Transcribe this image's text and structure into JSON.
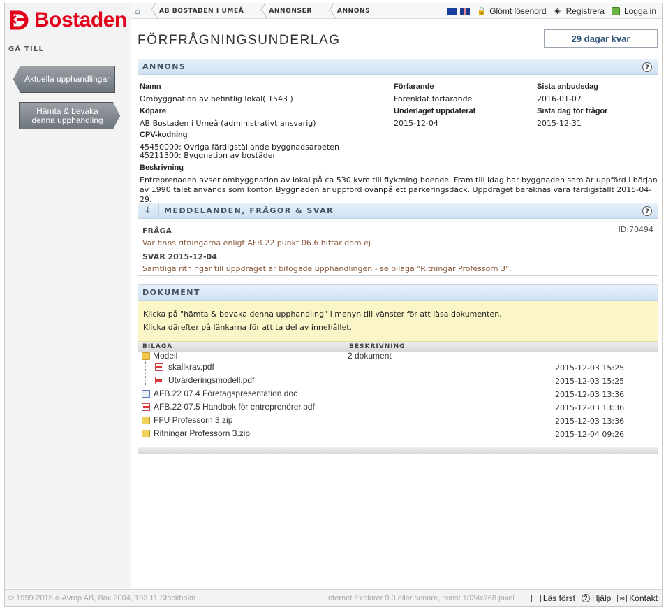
{
  "brand": {
    "name": "Bostaden",
    "color": "#e3001b"
  },
  "sidebar": {
    "goto_label": "GÅ TILL",
    "buttons": [
      {
        "label": "Aktuella upphandlingar"
      },
      {
        "label": "Hämta & bevaka denna upphandling"
      }
    ]
  },
  "breadcrumb": [
    "AB BOSTADEN I UMEÅ",
    "ANNONSER",
    "ANNONS"
  ],
  "toplinks": {
    "forgot": "Glömt lösenord",
    "register": "Registrera",
    "login": "Logga in"
  },
  "page": {
    "title": "FÖRFRÅGNINGSUNDERLAG",
    "days_left": "29 dagar kvar"
  },
  "annons": {
    "header": "ANNONS",
    "namn_label": "Namn",
    "namn": "Ombyggnation av befintlig lokal( 1543 )",
    "kopare_label": "Köpare",
    "kopare": "AB Bostaden i Umeå (administrativt ansvarig)",
    "cpv_label": "CPV-kodning",
    "cpv": [
      "45450000: Övriga färdigställande byggnadsarbeten",
      "45211300: Byggnation av bostäder"
    ],
    "beskrivning_label": "Beskrivning",
    "beskrivning": "Entreprenaden avser ombyggnation av lokal på ca 530 kvm till flyktning boende. Fram till idag har byggnaden som är uppförd i början av 1990 talet används som kontor. Byggnaden är uppförd ovanpå ett parkeringsdäck. Uppdraget beräknas vara färdigställt 2015-04-29.",
    "forfarande_label": "Förfarande",
    "forfarande": "Förenklat förfarande",
    "uppdaterat_label": "Underlaget uppdaterat",
    "uppdaterat": "2015-12-04",
    "anbudsdag_label": "Sista anbudsdag",
    "anbudsdag": "2016-01-07",
    "fragor_label": "Sista dag för frågor",
    "fragor": "2015-12-31"
  },
  "messages": {
    "header": "MEDDELANDEN, FRÅGOR & SVAR",
    "question_label": "FRÅGA",
    "question_id": "ID:70494",
    "question": "Var finns ritningarna enligt AFB.22 punkt 06.6 hittar dom ej.",
    "answer_label": "SVAR 2015-12-04",
    "answer": "Samtliga ritningar till uppdraget är bifogade upphandlingen - se bilaga \"Ritningar Professorn 3\"."
  },
  "documents": {
    "header": "DOKUMENT",
    "notice_1": "Klicka på \"hämta & bevaka denna upphandling\" i menyn till vänster för att läsa dokumenten.",
    "notice_2": "Klicka därefter på länkarna för att ta del av innehållet.",
    "col_bilaga": "BILAGA",
    "col_beskrivning": "BESKRIVNING",
    "rows": [
      {
        "name": "Modell",
        "desc": "2 dokument",
        "date": "",
        "type": "folder"
      },
      {
        "name": "skallkrav.pdf",
        "desc": "",
        "date": "2015-12-03 15:25",
        "type": "pdf"
      },
      {
        "name": "Utvärderingsmodell.pdf",
        "desc": "",
        "date": "2015-12-03 15:25",
        "type": "pdf"
      },
      {
        "name": "AFB.22 07.4 Företagspresentation.doc",
        "desc": "",
        "date": "2015-12-03 13:36",
        "type": "doc"
      },
      {
        "name": "AFB.22 07.5 Handbok för entreprenörer.pdf",
        "desc": "",
        "date": "2015-12-03 13:36",
        "type": "pdf"
      },
      {
        "name": "FFU Professorn 3.zip",
        "desc": "",
        "date": "2015-12-03 13:36",
        "type": "zip"
      },
      {
        "name": "Ritningar Professorn 3.zip",
        "desc": "",
        "date": "2015-12-04 09:26",
        "type": "zip"
      }
    ]
  },
  "footer": {
    "copyright": "© 1999-2015 e-Avrop AB, Box 2004, 103 11 Stockholm",
    "browser": "Internet Explorer 9.0 eller senare, minst 1024x768 pixel",
    "read_first": "Läs först",
    "help": "Hjälp",
    "contact": "Kontakt"
  }
}
